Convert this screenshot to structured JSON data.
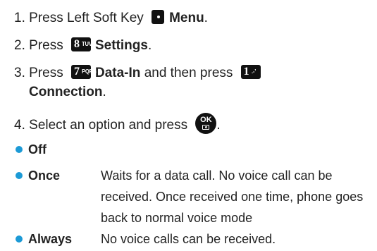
{
  "steps": [
    {
      "num": "1.",
      "pre": "Press Left Soft Key",
      "key": "soft-key",
      "label": "Menu",
      "post": "."
    },
    {
      "num": "2.",
      "pre": "Press",
      "key": "8",
      "key_sub": "TUV",
      "label": "Settings",
      "post": "."
    },
    {
      "num": "3.",
      "pre": "Press",
      "key": "7",
      "key_sub": "PQRS",
      "label": "Data-In",
      "mid": "and then press",
      "key2": "1",
      "key2_sub": ".-’",
      "label2": "Connection",
      "post": "."
    },
    {
      "num": "4.",
      "text": "Select an option and press",
      "post": "."
    }
  ],
  "ok_key": {
    "top": "OK"
  },
  "options": [
    {
      "name": "Off",
      "desc": ""
    },
    {
      "name": "Once",
      "desc": "Waits for a data call. No voice call can be received. Once received one time, phone goes back to normal voice mode"
    },
    {
      "name": "Always",
      "desc": "No voice calls can be received."
    }
  ],
  "colors": {
    "bullet": "#1c9ad6",
    "key": "#111111",
    "text": "#222222"
  },
  "icons": {
    "soft_key": "left-soft-key-icon",
    "ok": "ok-camera-key-icon"
  }
}
